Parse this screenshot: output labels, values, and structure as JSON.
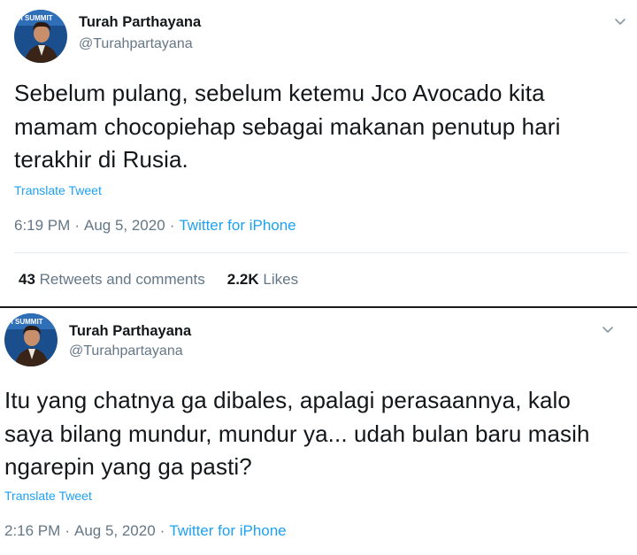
{
  "tweets": [
    {
      "display_name": "Turah Parthayana",
      "handle": "@Turahpartayana",
      "text": "Sebelum pulang, sebelum ketemu Jco Avocado kita mamam chocopiehap sebagai makanan penutup hari terakhir di Rusia.",
      "translate_label": "Translate Tweet",
      "time": "6:19 PM",
      "date": "Aug 5, 2020",
      "source": "Twitter for iPhone",
      "retweets_count": "43",
      "retweets_label": "Retweets and comments",
      "likes_count": "2.2K",
      "likes_label": "Likes",
      "avatar_banner_text": "H SUMMIT"
    },
    {
      "display_name": "Turah Parthayana",
      "handle": "@Turahpartayana",
      "text": "Itu yang chatnya ga dibales, apalagi perasaannya, kalo saya bilang mundur, mundur ya... udah bulan baru masih ngarepin yang ga pasti?",
      "translate_label": "Translate Tweet",
      "time": "2:16 PM",
      "date": "Aug 5, 2020",
      "source": "Twitter for iPhone",
      "avatar_banner_text": "H SUMMIT"
    }
  ],
  "separator": "·",
  "colors": {
    "link": "#1da1f2",
    "secondary_text": "#657786",
    "primary_text": "#14171a",
    "avatar_bg": "#1a4e8c"
  },
  "icons": {
    "menu": "chevron-down-icon"
  }
}
